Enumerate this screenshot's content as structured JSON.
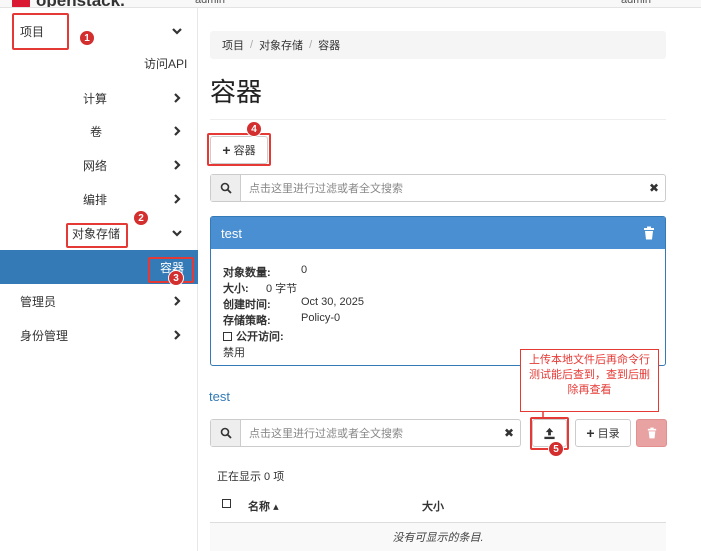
{
  "navbar": {
    "logo_text": "openstack.",
    "admin_label": "admin",
    "user_label": "admin"
  },
  "sidebar": {
    "project": "项目",
    "access_api": "访问API",
    "compute": "计算",
    "volumes": "卷",
    "network": "网络",
    "orchestration": "编排",
    "object_store": "对象存储",
    "containers": "容器",
    "admin": "管理员",
    "identity": "身份管理"
  },
  "breadcrumb": [
    "项目",
    "对象存储",
    "容器"
  ],
  "page_title": "容器",
  "toolbar": {
    "add_container_label": "容器"
  },
  "search": {
    "placeholder": "点击这里进行过滤或者全文搜索"
  },
  "container_panel": {
    "name": "test",
    "object_count_label": "对象数量:",
    "object_count": "0",
    "size_label": "大小:",
    "size": "0 字节",
    "created_label": "创建时间:",
    "created": "Oct 30, 2025",
    "policy_label": "存储策略:",
    "policy": "Policy-0",
    "public_label": "公开访问:",
    "public_status": "禁用"
  },
  "objects": {
    "container_link": "test",
    "search_placeholder": "点击这里进行过滤或者全文搜索",
    "folder_button": "目录",
    "count_text": "正在显示 0 项",
    "col_name": "名称",
    "col_size": "大小",
    "empty_text": "没有可显示的条目."
  },
  "annotations": {
    "badges": [
      "1",
      "2",
      "3",
      "4",
      "5"
    ],
    "callout_text": "上传本地文件后再命令行测试能后查到，查到后删除再查看"
  },
  "colors": {
    "primary": "#337ab7",
    "panel_head": "#4a8fd1",
    "annotation_red": "#e53935",
    "danger_button": "#e8a2a2"
  }
}
